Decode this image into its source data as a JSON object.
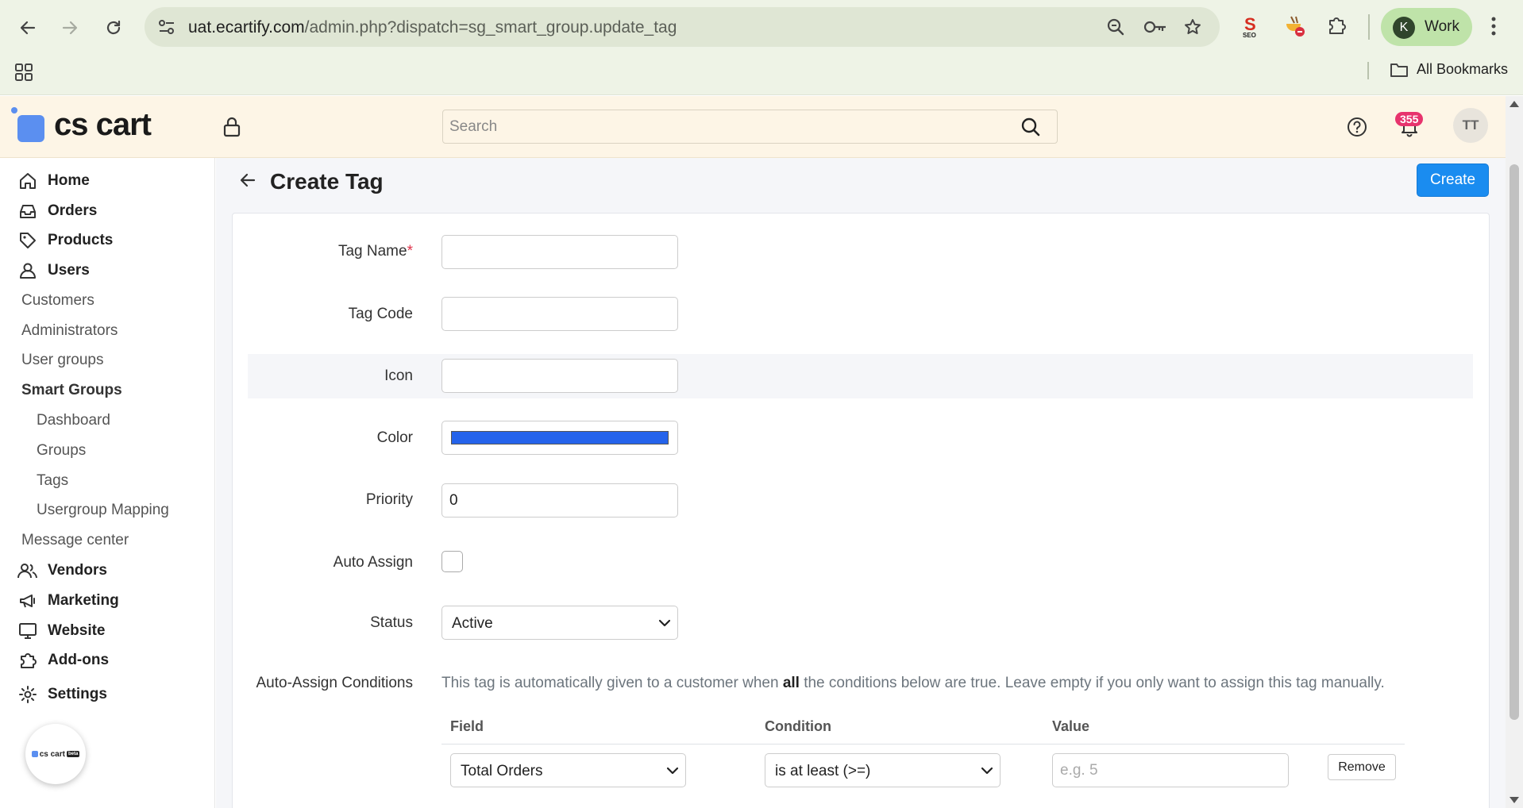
{
  "browser": {
    "url_host": "uat.ecartify.com",
    "url_path": "/admin.php?dispatch=sg_smart_group.update_tag",
    "profile_initial": "K",
    "profile_label": "Work",
    "all_bookmarks_label": "All Bookmarks",
    "seo_extension_label": "SEO"
  },
  "header": {
    "logo_text": "cs cart",
    "search_placeholder": "Search",
    "notification_count": "355",
    "user_initials": "TT"
  },
  "sidebar": {
    "items": {
      "home": "Home",
      "orders": "Orders",
      "products": "Products",
      "users": "Users",
      "customers": "Customers",
      "administrators": "Administrators",
      "user_groups": "User groups",
      "smart_groups": "Smart Groups",
      "dashboard": "Dashboard",
      "groups": "Groups",
      "tags": "Tags",
      "usergroup_mapping": "Usergroup Mapping",
      "message_center": "Message center",
      "vendors": "Vendors",
      "marketing": "Marketing",
      "website": "Website",
      "addons": "Add-ons",
      "settings": "Settings"
    },
    "mini_logo_text": "cs cart",
    "mini_logo_tag": "beta"
  },
  "page": {
    "title": "Create Tag",
    "create_button": "Create"
  },
  "form": {
    "tag_name_label": "Tag Name",
    "required_marker": "*",
    "tag_name_value": "",
    "tag_code_label": "Tag Code",
    "tag_code_value": "",
    "icon_label": "Icon",
    "icon_value": "",
    "color_label": "Color",
    "color_value": "#2563eb",
    "priority_label": "Priority",
    "priority_value": "0",
    "auto_assign_label": "Auto Assign",
    "auto_assign_checked": false,
    "status_label": "Status",
    "status_value": "Active",
    "conditions_label": "Auto-Assign Conditions",
    "conditions_help_before": "This tag is automatically given to a customer when ",
    "conditions_help_bold": "all",
    "conditions_help_after": " the conditions below are true. Leave empty if you only want to assign this tag manually.",
    "conditions_table": {
      "headers": {
        "field": "Field",
        "condition": "Condition",
        "value": "Value"
      },
      "rows": [
        {
          "field": "Total Orders",
          "condition": "is at least (>=)",
          "value": "",
          "value_placeholder": "e.g. 5",
          "remove_label": "Remove"
        }
      ]
    }
  }
}
